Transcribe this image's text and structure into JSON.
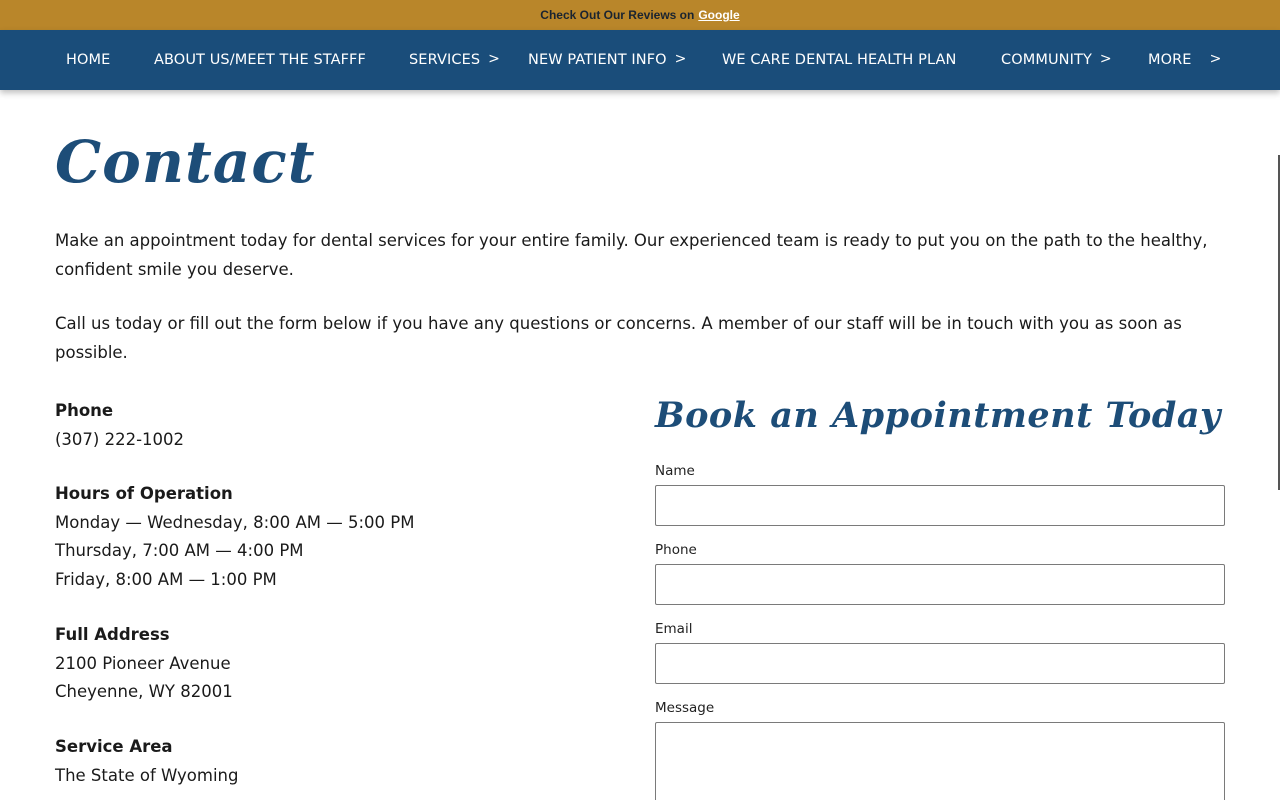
{
  "topbar": {
    "text": "Check Out Our Reviews on",
    "link": "Google"
  },
  "nav": {
    "items": [
      {
        "label": "HOME",
        "has_submenu": false
      },
      {
        "label": "ABOUT US/MEET THE STAFFF",
        "has_submenu": false
      },
      {
        "label": "SERVICES",
        "has_submenu": true
      },
      {
        "label": "NEW PATIENT INFO",
        "has_submenu": true
      },
      {
        "label": "WE CARE DENTAL HEALTH PLAN",
        "has_submenu": false
      },
      {
        "label": "COMMUNITY",
        "has_submenu": true
      },
      {
        "label": "MORE",
        "has_submenu": true
      }
    ]
  },
  "page": {
    "title": "Contact",
    "intro1": "Make an appointment today for dental services for your entire family. Our experienced team is ready to put you on the path to the healthy, confident smile you deserve.",
    "intro2": "Call us today or fill out the form below if you have any questions or concerns. A member of our staff will be in touch with you as soon as possible."
  },
  "info": {
    "phone_label": "Phone",
    "phone": "(307) 222-1002",
    "hours_label": "Hours of Operation",
    "hours": [
      "Monday — Wednesday, 8:00 AM — 5:00 PM",
      "Thursday, 7:00 AM — 4:00 PM",
      "Friday, 8:00 AM — 1:00 PM"
    ],
    "address_label": "Full Address",
    "address": [
      "2100 Pioneer Avenue",
      "Cheyenne, WY 82001"
    ],
    "service_label": "Service Area",
    "service_area": "The State of Wyoming"
  },
  "form": {
    "title": "Book an Appointment Today",
    "name_label": "Name",
    "phone_label": "Phone",
    "email_label": "Email",
    "message_label": "Message"
  },
  "colors": {
    "topbar": "#b9862a",
    "nav": "#1a4d7a",
    "heading": "#1d4d78"
  },
  "icons": {
    "submenu": "chevron-right-icon"
  }
}
